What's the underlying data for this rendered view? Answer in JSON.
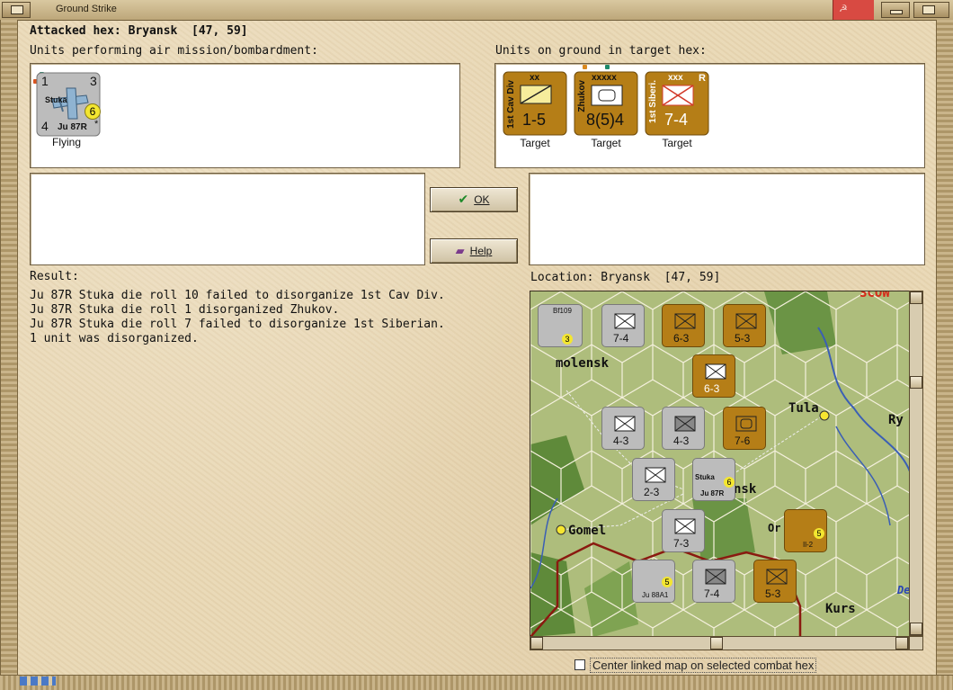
{
  "window": {
    "title": "Ground Strike"
  },
  "header": {
    "attacked_hex": "Attacked hex: Bryansk  [47, 59]"
  },
  "air_panel": {
    "label": "Units performing air mission/bombardment:",
    "units": [
      {
        "name": "Stuka",
        "type": "Ju 87R",
        "tl": "1",
        "tr": "3",
        "bl": "4",
        "circle": "6",
        "star": "*",
        "status": "Flying"
      }
    ]
  },
  "ground_panel": {
    "label": "Units on ground in target hex:",
    "units": [
      {
        "side_label": "1st Cav Div",
        "size": "xx",
        "strength": "1-5",
        "status": "Target"
      },
      {
        "side_label": "Zhukov",
        "size": "xxxxx",
        "strength": "8(5)4",
        "status": "Target"
      },
      {
        "side_label": "1st Siberi.",
        "size": "xxx",
        "badge": "R",
        "strength": "7-4",
        "status": "Target"
      }
    ]
  },
  "buttons": {
    "ok": "OK",
    "help": "Help"
  },
  "result": {
    "label": "Result:",
    "lines": [
      "Ju 87R Stuka die roll 10 failed to disorganize 1st Cav Div.",
      "Ju 87R Stuka die roll 1 disorganized Zhukov.",
      "Ju 87R Stuka die roll 7 failed to disorganize 1st Siberian.",
      "1 unit was disorganized."
    ]
  },
  "location": {
    "label": "Location: Bryansk  [47, 59]"
  },
  "map": {
    "place_names": {
      "smolensk": "molensk",
      "tula": "Tula",
      "bryansk": "nsk",
      "gomel": "Gomel",
      "orel": "Or",
      "kursk": "Kurs",
      "ry": "Ry",
      "moscow": "SCOW",
      "de": "De"
    },
    "counters": [
      {
        "label": "7-4"
      },
      {
        "label": "6-3"
      },
      {
        "label": "5-3"
      },
      {
        "label": "6-3"
      },
      {
        "label": "4-3"
      },
      {
        "label": "4-3"
      },
      {
        "label": "7-6"
      },
      {
        "label": "2-3"
      },
      {
        "label": "7-3"
      },
      {
        "label": "7-4"
      },
      {
        "label": "5-3"
      }
    ],
    "aircraft": [
      {
        "name": "Bf109",
        "circle": "3"
      },
      {
        "name": "Stuka",
        "type": "Ju 87R",
        "circle": "6"
      },
      {
        "name": "Il-2",
        "circle": "5"
      },
      {
        "name": "Ju 88A1",
        "circle": "5"
      }
    ]
  },
  "footer": {
    "checkbox_label": "Center linked map on selected combat hex",
    "checked": false
  },
  "colors": {
    "german": "#bcbcbc",
    "soviet": "#b57e17",
    "map_grass": "#a8b876",
    "map_forest": "#5f8a3a",
    "river": "#3b5fb5",
    "front_line": "#8a1a10"
  }
}
